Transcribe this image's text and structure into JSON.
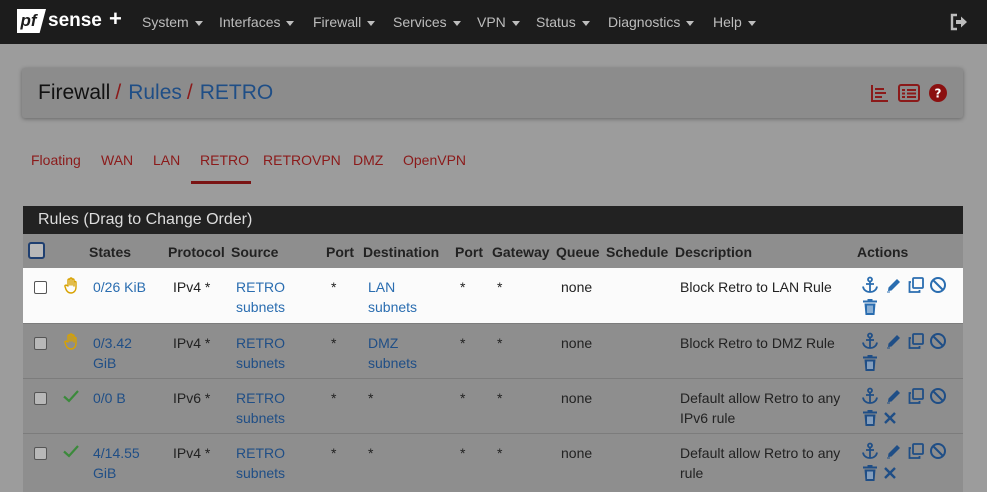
{
  "brand": {
    "prefix": "pf",
    "name": "sense",
    "suffix": "+"
  },
  "nav": {
    "items": [
      {
        "label": "System"
      },
      {
        "label": "Interfaces"
      },
      {
        "label": "Firewall"
      },
      {
        "label": "Services"
      },
      {
        "label": "VPN"
      },
      {
        "label": "Status"
      },
      {
        "label": "Diagnostics"
      },
      {
        "label": "Help"
      }
    ],
    "logout_icon": "sign-out-icon"
  },
  "breadcrumb": {
    "root": "Firewall",
    "section": "Rules",
    "current": "RETRO",
    "separator": "/"
  },
  "header_icons": [
    "bar-chart-icon",
    "list-icon",
    "help-icon"
  ],
  "tabs": [
    {
      "label": "Floating"
    },
    {
      "label": "WAN"
    },
    {
      "label": "LAN"
    },
    {
      "label": "RETRO",
      "active": true
    },
    {
      "label": "RETROVPN"
    },
    {
      "label": "DMZ"
    },
    {
      "label": "OpenVPN"
    }
  ],
  "table": {
    "title": "Rules (Drag to Change Order)",
    "columns": [
      "States",
      "Protocol",
      "Source",
      "Port",
      "Destination",
      "Port",
      "Gateway",
      "Queue",
      "Schedule",
      "Description",
      "Actions"
    ],
    "rows": [
      {
        "status_icon": "block-hand-icon",
        "states_l1": "0/26 KiB",
        "states_l2": "",
        "protocol": "IPv4 *",
        "source_l1": "RETRO",
        "source_l2": "subnets",
        "port": "*",
        "dest_l1": "LAN",
        "dest_l2": "subnets",
        "dest_port": "*",
        "gateway": "*",
        "queue": "none",
        "schedule": "",
        "desc_l1": "Block Retro to LAN Rule",
        "desc_l2": "",
        "actions": [
          "anchor-icon",
          "pencil-icon",
          "copy-icon",
          "disable-icon",
          "trash-icon"
        ]
      },
      {
        "status_icon": "block-hand-icon",
        "states_l1": "0/3.42",
        "states_l2": "GiB",
        "protocol": "IPv4 *",
        "source_l1": "RETRO",
        "source_l2": "subnets",
        "port": "*",
        "dest_l1": "DMZ",
        "dest_l2": "subnets",
        "dest_port": "*",
        "gateway": "*",
        "queue": "none",
        "schedule": "",
        "desc_l1": "Block Retro to DMZ Rule",
        "desc_l2": "",
        "actions": [
          "anchor-icon",
          "pencil-icon",
          "copy-icon",
          "disable-icon",
          "trash-icon"
        ]
      },
      {
        "status_icon": "pass-check-icon",
        "states_l1": "0/0 B",
        "states_l2": "",
        "protocol": "IPv6 *",
        "source_l1": "RETRO",
        "source_l2": "subnets",
        "port": "*",
        "dest_l1": "*",
        "dest_l2": "",
        "dest_port": "*",
        "gateway": "*",
        "queue": "none",
        "schedule": "",
        "desc_l1": "Default allow Retro to any",
        "desc_l2": "IPv6 rule",
        "actions": [
          "anchor-icon",
          "pencil-icon",
          "copy-icon",
          "disable-icon",
          "trash-icon",
          "delete-x-icon"
        ]
      },
      {
        "status_icon": "pass-check-icon",
        "states_l1": "4/14.55",
        "states_l2": "GiB",
        "protocol": "IPv4 *",
        "source_l1": "RETRO",
        "source_l2": "subnets",
        "port": "*",
        "dest_l1": "*",
        "dest_l2": "",
        "dest_port": "*",
        "gateway": "*",
        "queue": "none",
        "schedule": "",
        "desc_l1": "Default allow Retro to any",
        "desc_l2": "rule",
        "actions": [
          "anchor-icon",
          "pencil-icon",
          "copy-icon",
          "disable-icon",
          "trash-icon",
          "delete-x-icon"
        ]
      }
    ]
  },
  "colors": {
    "accent": "#8b1a1a",
    "link": "#1f4e86",
    "navbar": "#1c1c1c",
    "pass": "#3b8a3b",
    "block": "#d8a200"
  }
}
